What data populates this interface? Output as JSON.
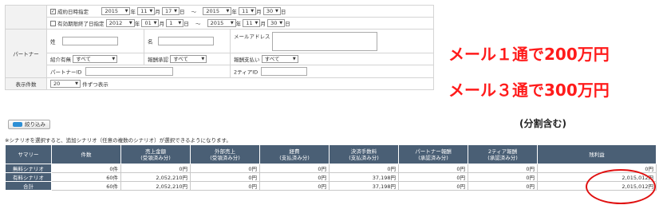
{
  "filter": {
    "contract_checkbox_label": "成約日時指定",
    "contract_from": {
      "year": "2015",
      "month": "11",
      "day": "17"
    },
    "contract_to": {
      "year": "2015",
      "month": "11",
      "day": "30"
    },
    "expiry_checkbox_label": "有効期限終了日指定",
    "expiry_from": {
      "year": "2012",
      "month": "01",
      "day": "1"
    },
    "expiry_to": {
      "year": "2015",
      "month": "11",
      "day": "30"
    },
    "year_unit": "年",
    "month_unit": "月",
    "day_unit": "日",
    "tilde": "～",
    "partner_label": "パートナー",
    "last_name_label": "姓",
    "first_name_label": "名",
    "email_label": "メールアドレス",
    "referral_label": "紹介有無",
    "referral_value": "すべて",
    "reward_approval_label": "報酬承認",
    "reward_approval_value": "すべて",
    "reward_payment_label": "報酬支払い",
    "reward_payment_value": "すべて",
    "partner_id_label": "パートナーID",
    "tier2_id_label": "2ティアID",
    "display_count_label": "表示件数",
    "display_count_value": "20",
    "per_page_label": "件ずつ表示"
  },
  "filter_button_label": "絞り込み",
  "note": "※シナリオを選択すると、追加シナリオ（任意の複数のシナリオ）が選択できるようになります。",
  "table": {
    "headers": [
      {
        "l1": "サマリー",
        "l2": ""
      },
      {
        "l1": "件数",
        "l2": ""
      },
      {
        "l1": "売上金額",
        "l2": "(受領済み分)"
      },
      {
        "l1": "外部売上",
        "l2": "(受領済み分)"
      },
      {
        "l1": "経費",
        "l2": "(支払済み分)"
      },
      {
        "l1": "決済手数料",
        "l2": "(支払済み分)"
      },
      {
        "l1": "パートナー報酬",
        "l2": "(承認済み分)"
      },
      {
        "l1": "2ティア報酬",
        "l2": "(承認済み分)"
      },
      {
        "l1": "残利益",
        "l2": ""
      }
    ],
    "rows": [
      {
        "label": "無料シナリオ",
        "cells": [
          "0件",
          "0円",
          "0円",
          "0円",
          "0円",
          "0円",
          "0円",
          "0円"
        ]
      },
      {
        "label": "有料シナリオ",
        "cells": [
          "60件",
          "2,052,210円",
          "0円",
          "0円",
          "37,198円",
          "0円",
          "0円",
          "2,015,012円"
        ]
      },
      {
        "label": "合計",
        "cells": [
          "60件",
          "2,052,210円",
          "0円",
          "0円",
          "37,198円",
          "0円",
          "0円",
          "2,015,012円"
        ]
      }
    ]
  },
  "annotations": {
    "line1": "メール１通で200万円",
    "line2": "メール３通で300万円",
    "line3": "(分割含む)"
  },
  "colors": {
    "header_bg": "#4a5f75",
    "accent_red": "#ff1b1b",
    "button_blue": "#2d8fd5"
  }
}
